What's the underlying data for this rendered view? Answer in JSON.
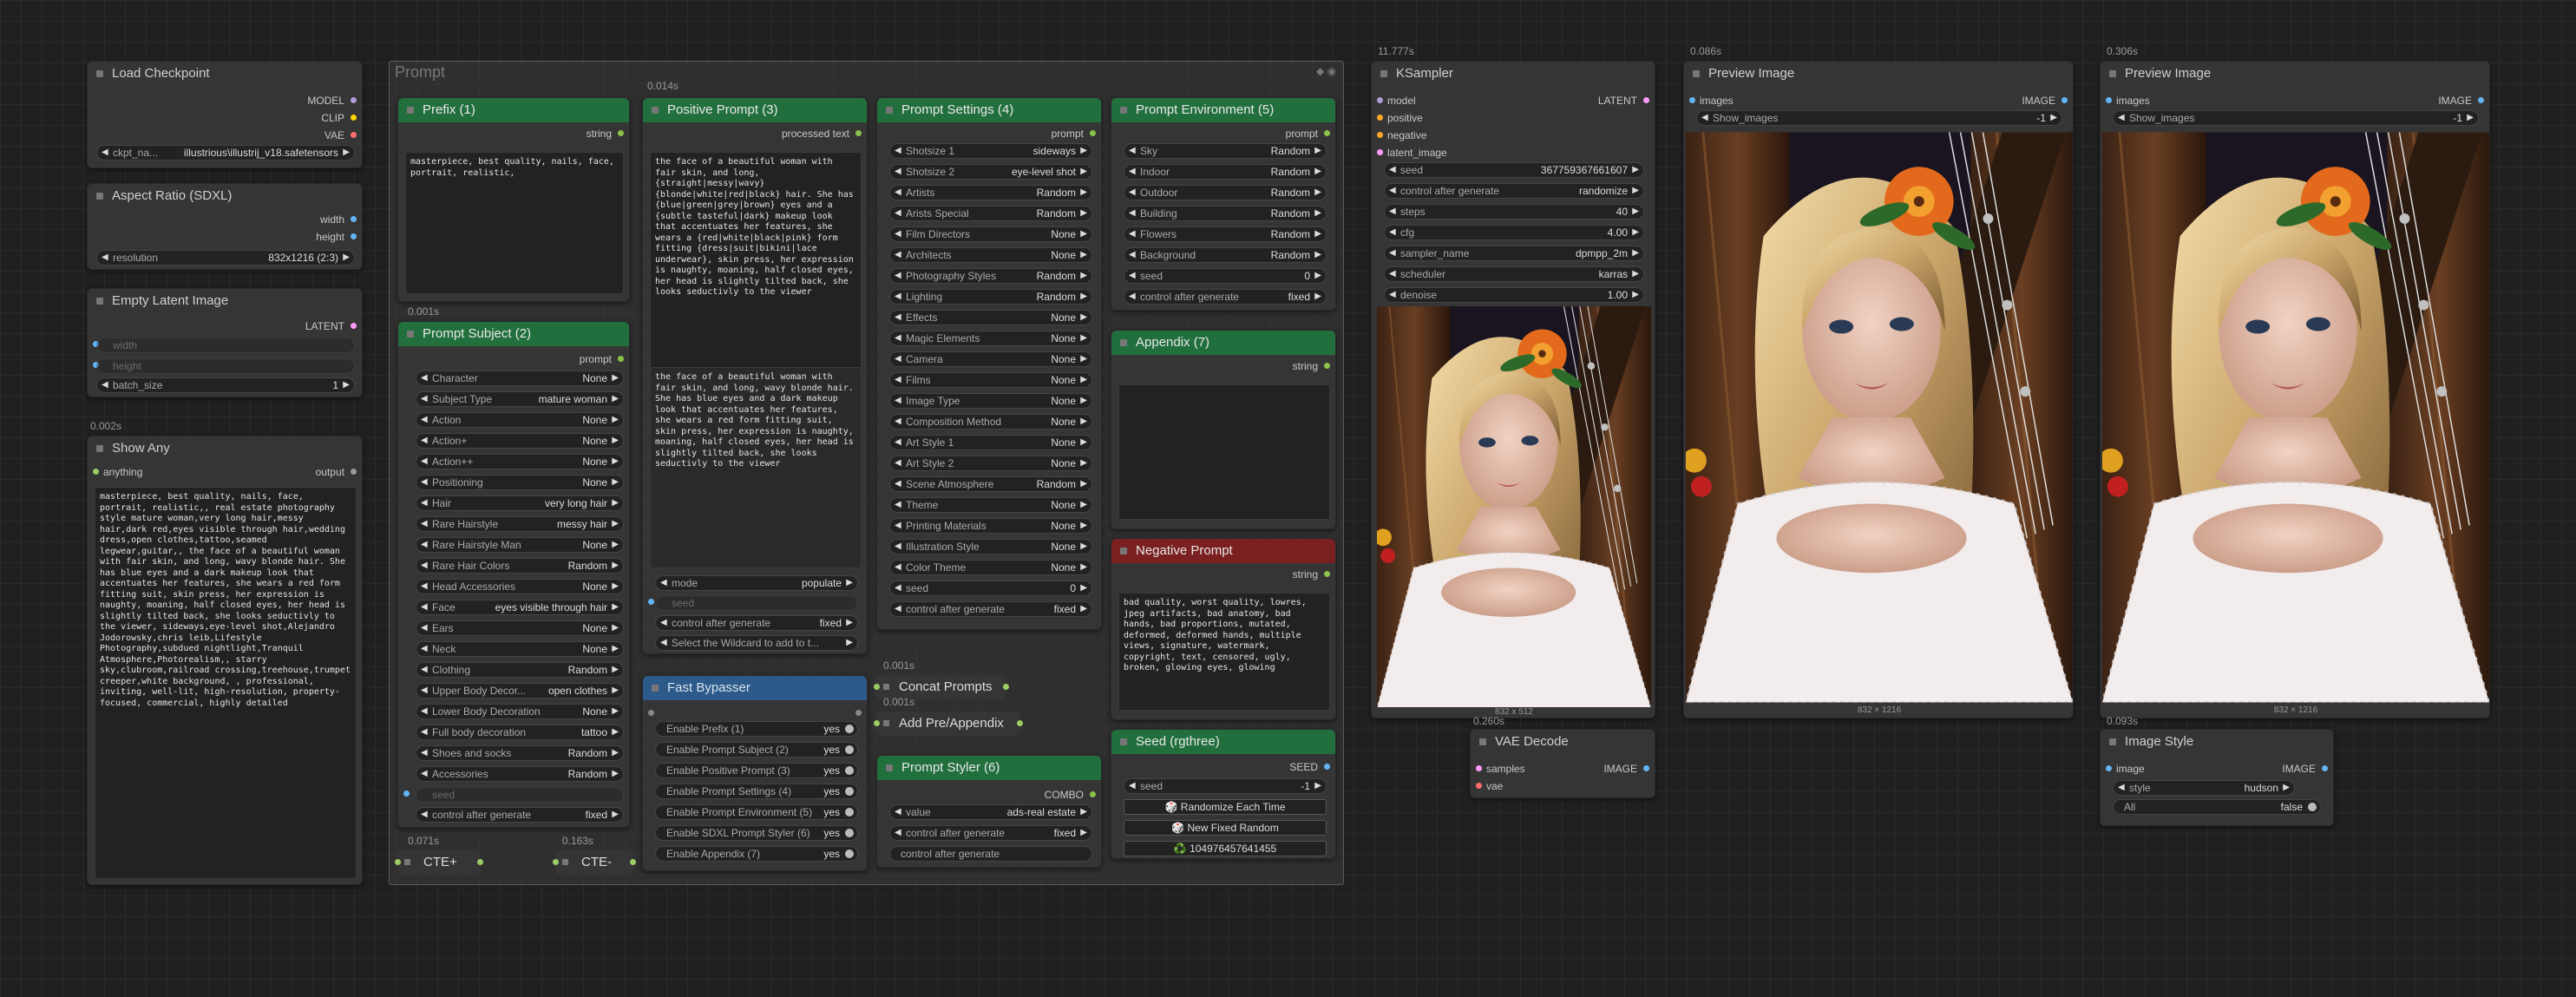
{
  "load_checkpoint": {
    "title": "Load Checkpoint",
    "outputs": [
      "MODEL",
      "CLIP",
      "VAE"
    ],
    "ckpt_label": "ckpt_na...",
    "ckpt_value": "illustrious\\illustrij_v18.safetensors"
  },
  "aspect_ratio": {
    "title": "Aspect Ratio (SDXL)",
    "outputs": [
      "width",
      "height"
    ],
    "label": "resolution",
    "value": "832x1216 (2:3)"
  },
  "empty_latent": {
    "title": "Empty Latent Image",
    "output": "LATENT",
    "width": "width",
    "height": "height",
    "batch_label": "batch_size",
    "batch_value": "1",
    "time": "0.002s"
  },
  "show_any": {
    "title": "Show Any",
    "input": "anything",
    "output": "output",
    "text": "masterpiece, best quality, nails, face, portrait, realistic,, real estate photography style mature woman,very long hair,messy hair,dark red,eyes visible through hair,wedding dress,open clothes,tattoo,seamed legwear,guitar,, the face of a beautiful woman with fair skin, and long, wavy blonde hair. She has blue eyes and a dark makeup look that accentuates her features, she wears a red form fitting suit, skin press, her expression is naughty, moaning, half closed eyes, her head is slightly tilted back, she looks seductivly to the viewer, sideways,eye-level shot,Alejandro Jodorowsky,chris leib,Lifestyle Photography,subdued nightlight,Tranquil Atmosphere,Photorealism,, starry sky,clubroom,railroad crossing,treehouse,trumpet creeper,white background, , professional, inviting, well-lit, high-resolution, property-focused, commercial, highly detailed"
  },
  "prompt_group": {
    "title": "Prompt"
  },
  "prefix": {
    "title": "Prefix (1)",
    "output": "string",
    "text": "masterpiece, best quality, nails, face, portrait, realistic,",
    "time": "0.001s"
  },
  "positive": {
    "title": "Positive Prompt (3)",
    "output": "processed text",
    "time": "0.014s",
    "text1": "the face of a beautiful woman with fair skin, and long, {straight|messy|wavy} {blonde|white|red|black} hair. She has {blue|green|grey|brown} eyes and a {subtle tasteful|dark} makeup look that accentuates her features, she wears a {red|white|black|pink} form fitting {dress|suit|bikini|lace underwear}, skin press, her expression is naughty, moaning, half closed eyes, her head is slightly tilted back, she looks seductivly to the viewer",
    "text2": "the face of a beautiful woman with fair skin, and long, wavy blonde hair. She has blue eyes and a dark makeup look that accentuates her features, she wears a red form fitting suit, skin press, her expression is naughty, moaning, half closed eyes, her head is slightly tilted back, she looks seductivly to the viewer",
    "mode_label": "mode",
    "mode_value": "populate",
    "seed": "seed",
    "cag_label": "control after generate",
    "cag_value": "fixed",
    "wildcard": "Select the Wildcard to add to t..."
  },
  "subject": {
    "title": "Prompt Subject (2)",
    "output": "prompt",
    "rows": [
      [
        "Character",
        "None"
      ],
      [
        "Subject Type",
        "mature woman"
      ],
      [
        "Action",
        "None"
      ],
      [
        "Action+",
        "None"
      ],
      [
        "Action++",
        "None"
      ],
      [
        "Positioning",
        "None"
      ],
      [
        "Hair",
        "very long hair"
      ],
      [
        "Rare Hairstyle",
        "messy hair"
      ],
      [
        "Rare Hairstyle Man",
        "None"
      ],
      [
        "Rare Hair Colors",
        "Random"
      ],
      [
        "Head Accessories",
        "None"
      ],
      [
        "Face",
        "eyes visible through hair"
      ],
      [
        "Ears",
        "None"
      ],
      [
        "Neck",
        "None"
      ],
      [
        "Clothing",
        "Random"
      ],
      [
        "Upper Body Decor...",
        "open clothes"
      ],
      [
        "Lower Body Decoration",
        "None"
      ],
      [
        "Full body decoration",
        "tattoo"
      ],
      [
        "Shoes and socks",
        "Random"
      ],
      [
        "Accessories",
        "Random"
      ]
    ],
    "seed": "seed",
    "cag_label": "control after generate",
    "cag_value": "fixed"
  },
  "settings": {
    "title": "Prompt Settings (4)",
    "output": "prompt",
    "rows": [
      [
        "Shotsize 1",
        "sideways"
      ],
      [
        "Shotsize 2",
        "eye-level shot"
      ],
      [
        "Artists",
        "Random"
      ],
      [
        "Arists Special",
        "Random"
      ],
      [
        "Film Directors",
        "None"
      ],
      [
        "Architects",
        "None"
      ],
      [
        "Photography Styles",
        "Random"
      ],
      [
        "Lighting",
        "Random"
      ],
      [
        "Effects",
        "None"
      ],
      [
        "Magic Elements",
        "None"
      ],
      [
        "Camera",
        "None"
      ],
      [
        "Films",
        "None"
      ],
      [
        "Image Type",
        "None"
      ],
      [
        "Composition Method",
        "None"
      ],
      [
        "Art Style 1",
        "None"
      ],
      [
        "Art Style 2",
        "None"
      ],
      [
        "Scene Atmosphere",
        "Random"
      ],
      [
        "Theme",
        "None"
      ],
      [
        "Printing Materials",
        "None"
      ],
      [
        "Illustration Style",
        "None"
      ],
      [
        "Color Theme",
        "None"
      ],
      [
        "seed",
        "0"
      ],
      [
        "control after generate",
        "fixed"
      ]
    ]
  },
  "environment": {
    "title": "Prompt Environment (5)",
    "output": "prompt",
    "rows": [
      [
        "Sky",
        "Random"
      ],
      [
        "Indoor",
        "Random"
      ],
      [
        "Outdoor",
        "Random"
      ],
      [
        "Building",
        "Random"
      ],
      [
        "Flowers",
        "Random"
      ],
      [
        "Background",
        "Random"
      ],
      [
        "seed",
        "0"
      ],
      [
        "control after generate",
        "fixed"
      ]
    ]
  },
  "appendix": {
    "title": "Appendix (7)",
    "output": "string"
  },
  "negative": {
    "title": "Negative Prompt",
    "output": "string",
    "text": "bad quality, worst quality, lowres, jpeg artifacts, bad anatomy, bad hands, bad proportions, mutated, deformed, deformed hands, multiple views, signature, watermark, copyright, text, censored, ugly, broken, glowing eyes, glowing"
  },
  "bypasser": {
    "title": "Fast Bypasser",
    "rows": [
      [
        "Enable Prefix (1)",
        "yes"
      ],
      [
        "Enable Prompt Subject (2)",
        "yes"
      ],
      [
        "Enable Positive Prompt (3)",
        "yes"
      ],
      [
        "Enable Prompt Settings (4)",
        "yes"
      ],
      [
        "Enable Prompt Environment (5)",
        "yes"
      ],
      [
        "Enable SDXL Prompt Styler (6)",
        "yes"
      ],
      [
        "Enable Appendix (7)",
        "yes"
      ]
    ]
  },
  "concat": {
    "title": "Concat Prompts",
    "time": "0.001s"
  },
  "addpre": {
    "title": "Add Pre/Appendix",
    "time": "0.001s"
  },
  "styler": {
    "title": "Prompt Styler (6)",
    "output": "COMBO",
    "value_label": "value",
    "value": "ads-real estate",
    "cag_label": "control after generate",
    "cag_value": "fixed",
    "cag2": "control after generate"
  },
  "seed_node": {
    "title": "Seed (rgthree)",
    "output": "SEED",
    "seed_label": "seed",
    "seed_value": "-1",
    "btn1": "🎲 Randomize Each Time",
    "btn2": "🎲 New Fixed Random",
    "btn3": "♻️ 104976457641455"
  },
  "cte1": {
    "title": "CTE+",
    "time": "0.071s"
  },
  "cte2": {
    "title": "CTE-",
    "time": "0.163s"
  },
  "ksampler": {
    "title": "KSampler",
    "time": "11.777s",
    "inputs": [
      "model",
      "positive",
      "negative",
      "latent_image"
    ],
    "output": "LATENT",
    "rows": [
      [
        "seed",
        "367759367661607"
      ],
      [
        "control after generate",
        "randomize"
      ],
      [
        "steps",
        "40"
      ],
      [
        "cfg",
        "4.00"
      ],
      [
        "sampler_name",
        "dpmpp_2m"
      ],
      [
        "scheduler",
        "karras"
      ],
      [
        "denoise",
        "1.00"
      ]
    ],
    "caption": "832 x 512"
  },
  "vae": {
    "title": "VAE Decode",
    "time": "0.260s",
    "inputs": [
      "samples",
      "vae"
    ],
    "output": "IMAGE"
  },
  "preview1": {
    "title": "Preview Image",
    "time": "0.086s",
    "input": "images",
    "output": "IMAGE",
    "label": "Show_images",
    "value": "-1",
    "caption": "832 × 1216"
  },
  "preview2": {
    "title": "Preview Image",
    "time": "0.306s",
    "input": "images",
    "output": "IMAGE",
    "label": "Show_images",
    "value": "-1",
    "caption": "832 × 1216"
  },
  "image_style": {
    "title": "Image Style",
    "time": "0.093s",
    "input": "image",
    "output": "IMAGE",
    "style_label": "style",
    "style_value": "hudson",
    "all_label": "All",
    "all_value": "false"
  },
  "colors": {
    "green": "#226f3e",
    "red": "#7a2020",
    "blue": "#2c5a8a",
    "bg": "#202020"
  }
}
